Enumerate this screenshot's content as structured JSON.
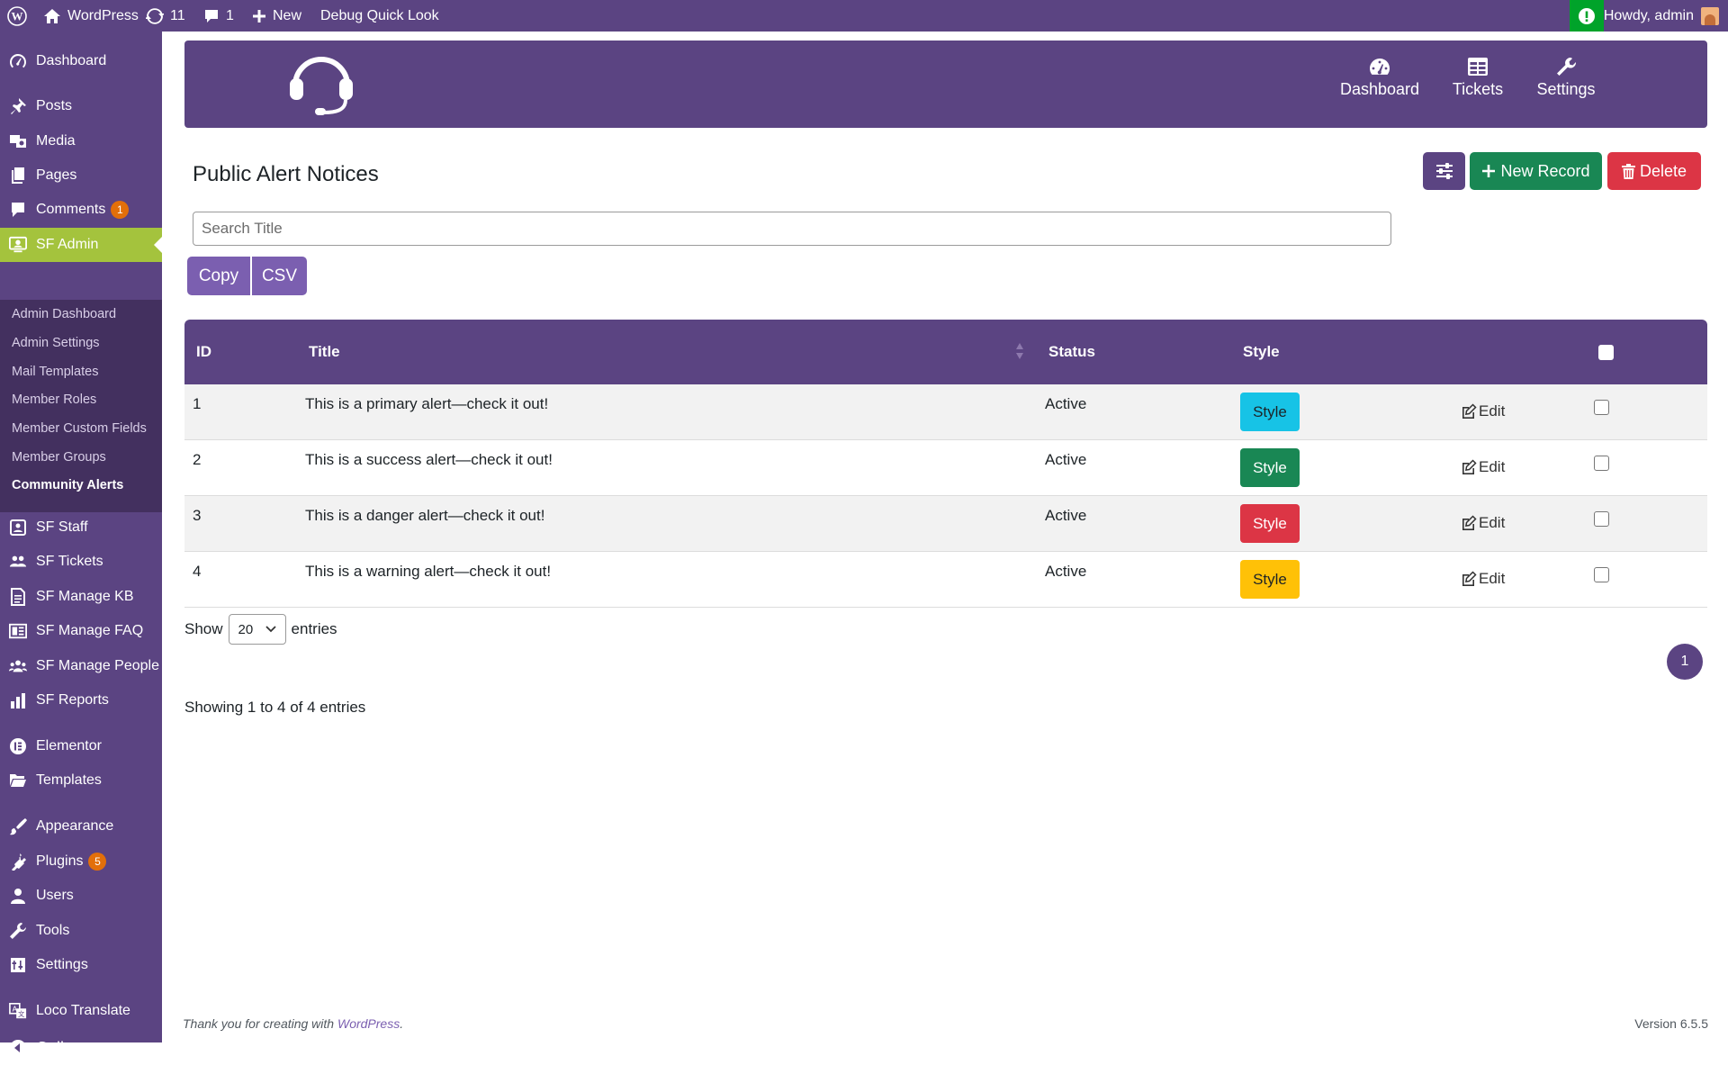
{
  "admin_bar": {
    "site_name": "WordPress",
    "updates_count": "11",
    "comments_count": "1",
    "new_label": "New",
    "debug_label": "Debug Quick Look",
    "howdy": "Howdy, admin"
  },
  "sidebar": {
    "dashboard": "Dashboard",
    "posts": "Posts",
    "media": "Media",
    "pages": "Pages",
    "comments": "Comments",
    "comments_badge": "1",
    "sf_admin": "SF Admin",
    "submenu": [
      "Admin Dashboard",
      "Admin Settings",
      "Mail Templates",
      "Member Roles",
      "Member Custom Fields",
      "Member Groups",
      "Community Alerts"
    ],
    "sf_staff": "SF Staff",
    "sf_tickets": "SF Tickets",
    "sf_manage_kb": "SF Manage KB",
    "sf_manage_faq": "SF Manage FAQ",
    "sf_manage_people": "SF Manage People",
    "sf_reports": "SF Reports",
    "elementor": "Elementor",
    "templates": "Templates",
    "appearance": "Appearance",
    "plugins": "Plugins",
    "plugins_badge": "5",
    "users": "Users",
    "tools": "Tools",
    "settings": "Settings",
    "loco": "Loco Translate",
    "collapse": "Collapse menu"
  },
  "brand_nav": {
    "dashboard": "Dashboard",
    "tickets": "Tickets",
    "settings": "Settings"
  },
  "page": {
    "title": "Public Alert Notices",
    "new_record": "New Record",
    "delete": "Delete",
    "search_placeholder": "Search Title",
    "copy": "Copy",
    "csv": "CSV"
  },
  "table": {
    "headers": {
      "id": "ID",
      "title": "Title",
      "status": "Status",
      "style": "Style"
    },
    "rows": [
      {
        "id": "1",
        "title": "This is a primary alert—check it out!",
        "status": "Active",
        "style_label": "Style",
        "style_color": "#17c3e6",
        "edit": "Edit"
      },
      {
        "id": "2",
        "title": "This is a success alert—check it out!",
        "status": "Active",
        "style_label": "Style",
        "style_color": "#198754",
        "edit": "Edit"
      },
      {
        "id": "3",
        "title": "This is a danger alert—check it out!",
        "status": "Active",
        "style_label": "Style",
        "style_color": "#dc3545",
        "edit": "Edit"
      },
      {
        "id": "4",
        "title": "This is a warning alert—check it out!",
        "status": "Active",
        "style_label": "Style",
        "style_color": "#ffc107",
        "edit": "Edit"
      }
    ]
  },
  "length": {
    "show": "Show",
    "value": "20",
    "entries": "entries"
  },
  "pagination": {
    "current": "1"
  },
  "info": "Showing 1 to 4 of 4 entries",
  "footer": {
    "thanks_prefix": "Thank you for creating with ",
    "thanks_link": "WordPress",
    "thanks_suffix": ".",
    "version": "Version 6.5.5"
  },
  "colors": {
    "brand": "#5b4482",
    "success": "#198754",
    "danger": "#dc3545",
    "menu_current": "#a4c33d"
  }
}
